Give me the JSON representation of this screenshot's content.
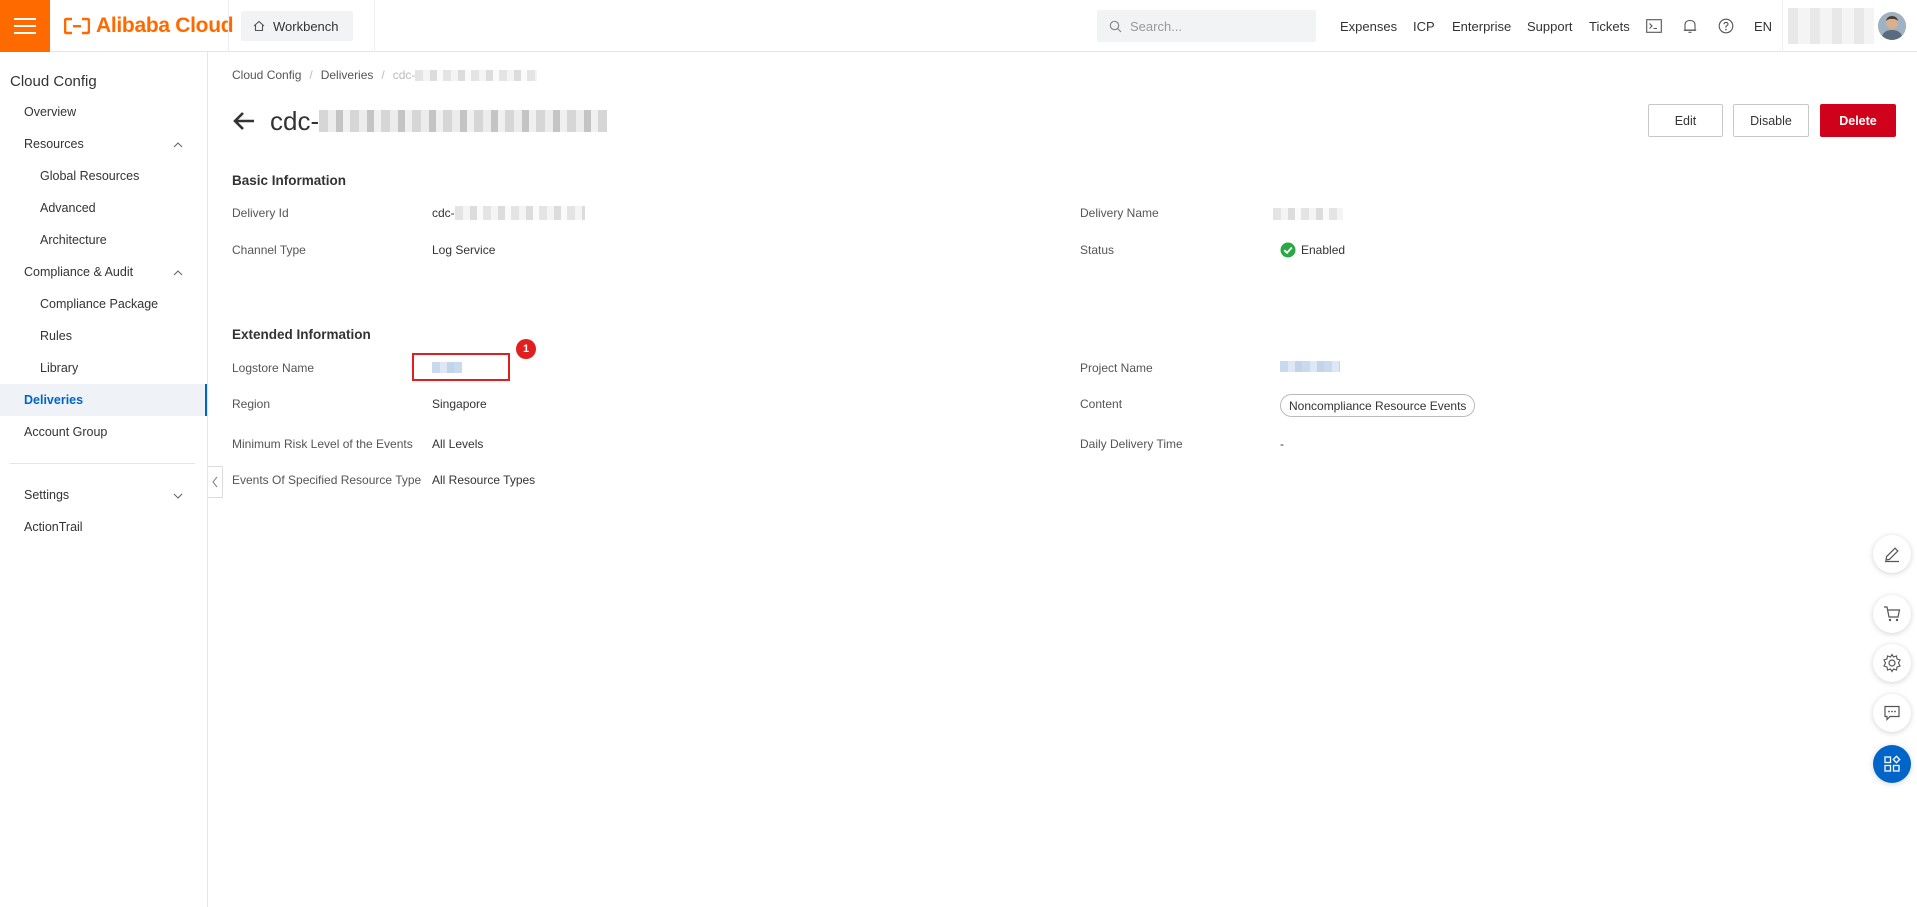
{
  "topbar": {
    "brand": "Alibaba Cloud",
    "workbench": "Workbench",
    "search_placeholder": "Search...",
    "nav": [
      "Expenses",
      "ICP",
      "Enterprise",
      "Support",
      "Tickets"
    ],
    "lang": "EN"
  },
  "sidebar": {
    "title": "Cloud Config",
    "items": {
      "overview": "Overview",
      "resources": "Resources",
      "global_resources": "Global Resources",
      "advanced": "Advanced",
      "architecture": "Architecture",
      "compliance_audit": "Compliance & Audit",
      "compliance_package": "Compliance Package",
      "rules": "Rules",
      "library": "Library",
      "deliveries": "Deliveries",
      "account_group": "Account Group",
      "settings": "Settings",
      "actiontrail": "ActionTrail"
    }
  },
  "breadcrumb": {
    "root": "Cloud Config",
    "section": "Deliveries",
    "current_prefix": "cdc-"
  },
  "page": {
    "title_prefix": "cdc-",
    "buttons": {
      "edit": "Edit",
      "disable": "Disable",
      "delete": "Delete"
    }
  },
  "basic": {
    "title": "Basic Information",
    "delivery_id_label": "Delivery Id",
    "delivery_id_prefix": "cdc-",
    "channel_type_label": "Channel Type",
    "channel_type_value": "Log Service",
    "delivery_name_label": "Delivery Name",
    "status_label": "Status",
    "status_value": "Enabled"
  },
  "extended": {
    "title": "Extended Information",
    "logstore_label": "Logstore Name",
    "region_label": "Region",
    "region_value": "Singapore",
    "min_risk_label": "Minimum Risk Level of the Events",
    "min_risk_value": "All Levels",
    "events_type_label": "Events Of Specified Resource Type",
    "events_type_value": "All Resource Types",
    "project_label": "Project Name",
    "content_label": "Content",
    "content_value": "Noncompliance Resource Events",
    "daily_time_label": "Daily Delivery Time",
    "daily_time_value": "-"
  },
  "annotation": {
    "badge": "1"
  },
  "colors": {
    "brand": "#ff6a00",
    "primary": "#0064c8",
    "danger": "#d0021b",
    "success": "#2aa845"
  }
}
